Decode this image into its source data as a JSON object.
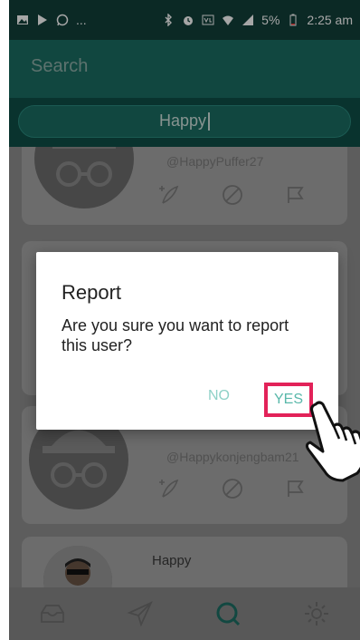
{
  "statusbar": {
    "left_icons": [
      "image-icon",
      "play-store-icon",
      "whatsapp-icon"
    ],
    "ellipsis": "...",
    "battery_percent": "5%",
    "time": "2:25 am",
    "right_icons": [
      "bluetooth-icon",
      "alarm-icon",
      "volte-icon",
      "wifi-icon",
      "signal-icon",
      "battery-icon"
    ]
  },
  "appbar": {
    "search_label": "Search"
  },
  "search": {
    "query": "Happy"
  },
  "results": [
    {
      "handle": "@HappyPuffer27",
      "actions": [
        "add-feather-icon",
        "block-icon",
        "report-flag-icon"
      ]
    },
    {
      "handle": "",
      "actions": []
    },
    {
      "handle": "@Happykonjengbam21",
      "actions": [
        "add-feather-icon",
        "block-icon",
        "report-flag-icon"
      ]
    },
    {
      "name": "Happy"
    }
  ],
  "dialog": {
    "title": "Report",
    "message": "Are you sure you want to report this user?",
    "no_label": "NO",
    "yes_label": "YES",
    "highlight_color": "#e22259"
  },
  "bottomnav": {
    "items": [
      "inbox-icon",
      "send-icon",
      "search-icon",
      "settings-icon"
    ]
  }
}
